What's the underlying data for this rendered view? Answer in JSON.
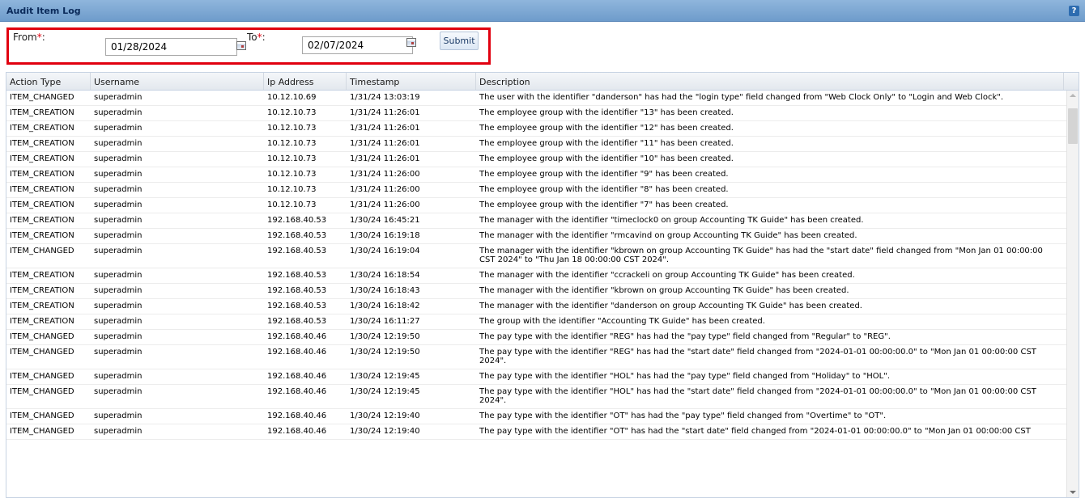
{
  "title": "Audit Item Log",
  "help_label": "?",
  "filter": {
    "from_label": "From",
    "to_label": "To",
    "required_mark": "*",
    "colon": ":",
    "from_value": "01/28/2024",
    "to_value": "02/07/2024",
    "submit_label": "Submit",
    "calendar_icon": "calendar-icon"
  },
  "columns": [
    "Action Type",
    "Username",
    "Ip Address",
    "Timestamp",
    "Description"
  ],
  "rows": [
    {
      "action": "ITEM_CHANGED",
      "user": "superadmin",
      "ip": "10.12.10.69",
      "ts": "1/31/24 13:03:19",
      "desc": "The user with the identifier \"danderson\" has had the \"login type\" field changed from \"Web Clock Only\" to \"Login and Web Clock\"."
    },
    {
      "action": "ITEM_CREATION",
      "user": "superadmin",
      "ip": "10.12.10.73",
      "ts": "1/31/24 11:26:01",
      "desc": "The employee group with the identifier \"13\" has been created."
    },
    {
      "action": "ITEM_CREATION",
      "user": "superadmin",
      "ip": "10.12.10.73",
      "ts": "1/31/24 11:26:01",
      "desc": "The employee group with the identifier \"12\" has been created."
    },
    {
      "action": "ITEM_CREATION",
      "user": "superadmin",
      "ip": "10.12.10.73",
      "ts": "1/31/24 11:26:01",
      "desc": "The employee group with the identifier \"11\" has been created."
    },
    {
      "action": "ITEM_CREATION",
      "user": "superadmin",
      "ip": "10.12.10.73",
      "ts": "1/31/24 11:26:01",
      "desc": "The employee group with the identifier \"10\" has been created."
    },
    {
      "action": "ITEM_CREATION",
      "user": "superadmin",
      "ip": "10.12.10.73",
      "ts": "1/31/24 11:26:00",
      "desc": "The employee group with the identifier \"9\" has been created."
    },
    {
      "action": "ITEM_CREATION",
      "user": "superadmin",
      "ip": "10.12.10.73",
      "ts": "1/31/24 11:26:00",
      "desc": "The employee group with the identifier \"8\" has been created."
    },
    {
      "action": "ITEM_CREATION",
      "user": "superadmin",
      "ip": "10.12.10.73",
      "ts": "1/31/24 11:26:00",
      "desc": "The employee group with the identifier \"7\" has been created."
    },
    {
      "action": "ITEM_CREATION",
      "user": "superadmin",
      "ip": "192.168.40.53",
      "ts": "1/30/24 16:45:21",
      "desc": "The manager with the identifier \"timeclock0 on group Accounting TK Guide\" has been created."
    },
    {
      "action": "ITEM_CREATION",
      "user": "superadmin",
      "ip": "192.168.40.53",
      "ts": "1/30/24 16:19:18",
      "desc": "The manager with the identifier \"rmcavind on group Accounting TK Guide\" has been created."
    },
    {
      "action": "ITEM_CHANGED",
      "user": "superadmin",
      "ip": "192.168.40.53",
      "ts": "1/30/24 16:19:04",
      "desc": "The manager with the identifier \"kbrown on group Accounting TK Guide\" has had the \"start date\" field changed from \"Mon Jan 01 00:00:00 CST 2024\" to \"Thu Jan 18 00:00:00 CST 2024\".",
      "tall": true
    },
    {
      "action": "ITEM_CREATION",
      "user": "superadmin",
      "ip": "192.168.40.53",
      "ts": "1/30/24 16:18:54",
      "desc": "The manager with the identifier \"ccrackeli on group Accounting TK Guide\" has been created."
    },
    {
      "action": "ITEM_CREATION",
      "user": "superadmin",
      "ip": "192.168.40.53",
      "ts": "1/30/24 16:18:43",
      "desc": "The manager with the identifier \"kbrown on group Accounting TK Guide\" has been created."
    },
    {
      "action": "ITEM_CREATION",
      "user": "superadmin",
      "ip": "192.168.40.53",
      "ts": "1/30/24 16:18:42",
      "desc": "The manager with the identifier \"danderson on group Accounting TK Guide\" has been created."
    },
    {
      "action": "ITEM_CREATION",
      "user": "superadmin",
      "ip": "192.168.40.53",
      "ts": "1/30/24 16:11:27",
      "desc": "The group with the identifier \"Accounting TK Guide\" has been created."
    },
    {
      "action": "ITEM_CHANGED",
      "user": "superadmin",
      "ip": "192.168.40.46",
      "ts": "1/30/24 12:19:50",
      "desc": "The pay type with the identifier \"REG\" has had the \"pay type\" field changed from \"Regular\" to \"REG\"."
    },
    {
      "action": "ITEM_CHANGED",
      "user": "superadmin",
      "ip": "192.168.40.46",
      "ts": "1/30/24 12:19:50",
      "desc": "The pay type with the identifier \"REG\" has had the \"start date\" field changed from \"2024-01-01 00:00:00.0\" to \"Mon Jan 01 00:00:00 CST 2024\".",
      "tall": true
    },
    {
      "action": "ITEM_CHANGED",
      "user": "superadmin",
      "ip": "192.168.40.46",
      "ts": "1/30/24 12:19:45",
      "desc": "The pay type with the identifier \"HOL\" has had the \"pay type\" field changed from \"Holiday\" to \"HOL\"."
    },
    {
      "action": "ITEM_CHANGED",
      "user": "superadmin",
      "ip": "192.168.40.46",
      "ts": "1/30/24 12:19:45",
      "desc": "The pay type with the identifier \"HOL\" has had the \"start date\" field changed from \"2024-01-01 00:00:00.0\" to \"Mon Jan 01 00:00:00 CST 2024\".",
      "tall": true
    },
    {
      "action": "ITEM_CHANGED",
      "user": "superadmin",
      "ip": "192.168.40.46",
      "ts": "1/30/24 12:19:40",
      "desc": "The pay type with the identifier \"OT\" has had the \"pay type\" field changed from \"Overtime\" to \"OT\"."
    },
    {
      "action": "ITEM_CHANGED",
      "user": "superadmin",
      "ip": "192.168.40.46",
      "ts": "1/30/24 12:19:40",
      "desc": "The pay type with the identifier \"OT\" has had the \"start date\" field changed from \"2024-01-01 00:00:00.0\" to \"Mon Jan 01 00:00:00 CST"
    }
  ]
}
